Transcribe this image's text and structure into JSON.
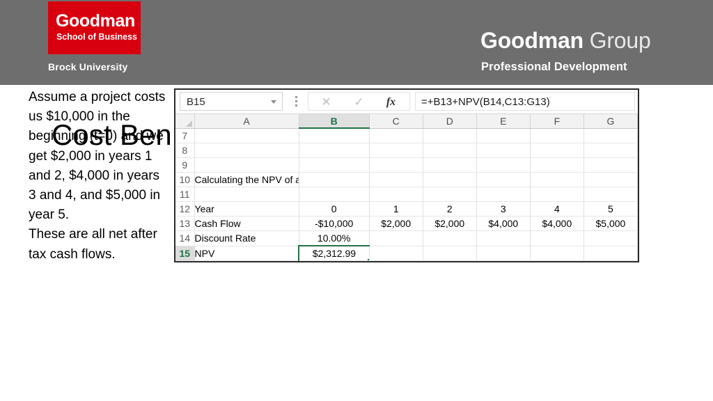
{
  "header": {
    "logo": {
      "brand": "Goodman",
      "tagline": "School of Business",
      "university": "Brock University"
    },
    "group_title_bold": "Goodman",
    "group_title_light": " Group",
    "group_subtitle": "Professional Development",
    "colors": {
      "band": "#6e6e6e",
      "logo_red": "#d8000f"
    }
  },
  "slide": {
    "title": "Cost Ben",
    "body": [
      "Assume a project costs us $10,000 in the beginning (t=0) and we get $2,000 in years 1 and 2, $4,000 in years 3 and 4, and $5,000 in year 5.",
      "These are all net after tax cash flows."
    ]
  },
  "excel": {
    "name_box_value": "B15",
    "name_box_placeholder": "Name Box",
    "cancel_label": "✕",
    "enter_label": "✓",
    "fx_label": "fx",
    "formula_value": "=+B13+NPV(B14,C13:G13)",
    "formula_placeholder": "Formula Bar",
    "selected_cell": "B15",
    "selected_column": "B",
    "selected_row": "15",
    "accent_color": "#217346",
    "columns": [
      "A",
      "B",
      "C",
      "D",
      "E",
      "F",
      "G"
    ],
    "rows": [
      {
        "num": "7",
        "cells": [
          "",
          "",
          "",
          "",
          "",
          "",
          ""
        ]
      },
      {
        "num": "8",
        "cells": [
          "",
          "",
          "",
          "",
          "",
          "",
          ""
        ]
      },
      {
        "num": "9",
        "cells": [
          "",
          "",
          "",
          "",
          "",
          "",
          ""
        ]
      },
      {
        "num": "10",
        "cells": [
          "Calculating the NPV of a Project",
          "",
          "",
          "",
          "",
          "",
          ""
        ]
      },
      {
        "num": "11",
        "cells": [
          "",
          "",
          "",
          "",
          "",
          "",
          ""
        ]
      },
      {
        "num": "12",
        "cells": [
          "Year",
          "0",
          "1",
          "2",
          "3",
          "4",
          "5"
        ]
      },
      {
        "num": "13",
        "cells": [
          "Cash Flow",
          "-$10,000",
          "$2,000",
          "$2,000",
          "$4,000",
          "$4,000",
          "$5,000"
        ]
      },
      {
        "num": "14",
        "cells": [
          "Discount Rate",
          "10.00%",
          "",
          "",
          "",
          "",
          ""
        ]
      },
      {
        "num": "15",
        "cells": [
          "NPV",
          "$2,312.99",
          "",
          "",
          "",
          "",
          ""
        ]
      }
    ]
  },
  "chart_data": {
    "type": "table",
    "title": "Calculating the NPV of a Project",
    "categories": [
      "0",
      "1",
      "2",
      "3",
      "4",
      "5"
    ],
    "series": [
      {
        "name": "Cash Flow",
        "values": [
          -10000,
          2000,
          2000,
          4000,
          4000,
          5000
        ]
      }
    ],
    "discount_rate": 0.1,
    "npv": 2312.99,
    "xlabel": "Year",
    "ylabel": "Cash Flow"
  }
}
